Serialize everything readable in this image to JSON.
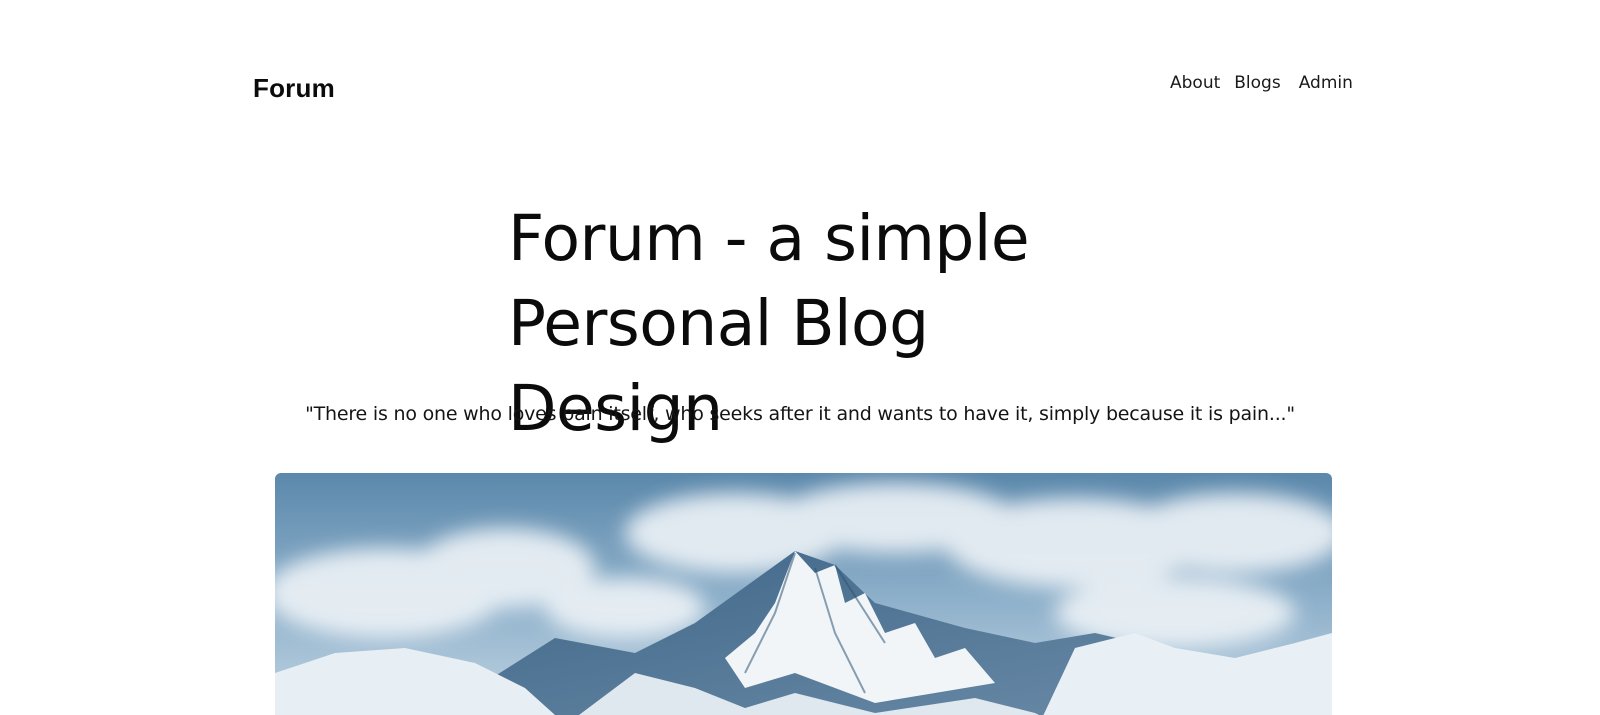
{
  "header": {
    "logo": "Forum",
    "nav": [
      {
        "label": "About"
      },
      {
        "label": "Blogs"
      },
      {
        "label": "Admin"
      }
    ]
  },
  "hero": {
    "title_line1": "Forum - a simple",
    "title_line2": "Personal Blog Design",
    "quote": "\"There is no one who loves pain itself, who seeks after it and wants to have it, simply because it is pain...\"",
    "image": {
      "alt": "snowy-mountain-photo"
    }
  }
}
